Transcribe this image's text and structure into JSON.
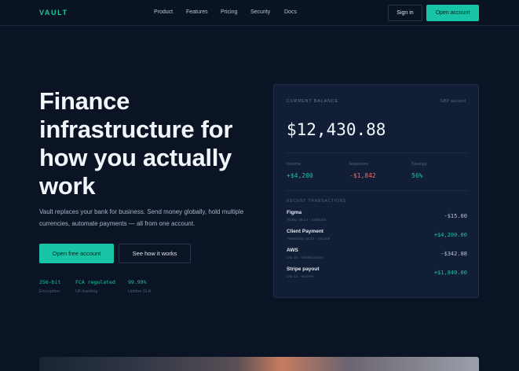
{
  "nav": {
    "logo": "VAULT",
    "links": [
      "Product",
      "Features",
      "Pricing",
      "Security",
      "Docs"
    ],
    "signin_label": "Sign in",
    "open_account_label": "Open account"
  },
  "hero": {
    "title": "Finance infrastructure for how you actually work",
    "subtitle": "Vault replaces your bank for business. Send money globally, hold multiple currencies, automate payments — all from one account.",
    "primary_cta": "Open free account",
    "secondary_cta": "See how it works",
    "stats": [
      {
        "value": "256-bit",
        "label": "Encryption"
      },
      {
        "value": "FCA regulated",
        "label": "UK banking"
      },
      {
        "value": "99.99%",
        "label": "Uptime SLA"
      }
    ]
  },
  "card": {
    "label": "CURRENT BALANCE",
    "account": "GBP account",
    "balance": "$12,430.88",
    "metrics": [
      {
        "label": "Income",
        "value": "+$4,200"
      },
      {
        "label": "Expenses",
        "value": "-$1,842"
      },
      {
        "label": "Savings",
        "value": "56%"
      }
    ],
    "recent_label": "RECENT TRANSACTIONS",
    "transactions": [
      {
        "name": "Figma",
        "meta": "Today, 09:14 · Software",
        "amount": "-$15.00"
      },
      {
        "name": "Client Payment",
        "meta": "Yesterday, 16:42 · Income",
        "amount": "+$4,200.00"
      },
      {
        "name": "AWS",
        "meta": "Oct 16 · Infrastructure",
        "amount": "-$342.88"
      },
      {
        "name": "Stripe payout",
        "meta": "Oct 12 · Income",
        "amount": "+$1,840.00"
      }
    ]
  },
  "colors": {
    "background": "#0b1424",
    "accent": "#19c4a6",
    "negative": "#f06b6b",
    "card": "#111e36"
  }
}
